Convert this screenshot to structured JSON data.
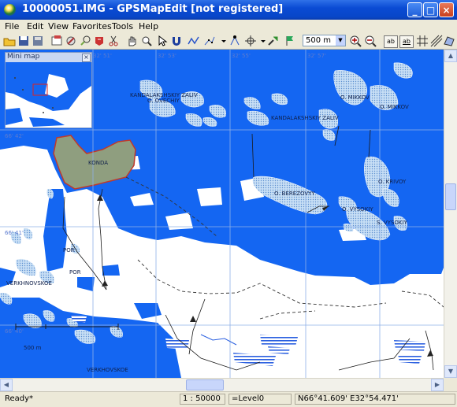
{
  "window": {
    "title": "10000051.IMG - GPSMapEdit [not registered]"
  },
  "menu": [
    "File",
    "Edit",
    "View",
    "Favorites",
    "Tools",
    "Help"
  ],
  "toolbar": {
    "scale_value": "500 m",
    "toggle_labels": [
      "ab",
      "ab"
    ]
  },
  "minimap": {
    "title": "Mini map"
  },
  "map": {
    "longitude_ticks": [
      "32' 51'",
      "32' 53'",
      "32' 55'",
      "32' 57'"
    ],
    "latitude_ticks": [
      "66' 42'",
      "66' 41'",
      "66' 40'"
    ],
    "labels": {
      "kandalakshskiy_zaliv_1": "KANDALAKSHSKIY ZALIV",
      "o_ovechiy": "O. OVECHIY",
      "kandalakshskiy_zaliv_2": "KANDALAKSHSKIY ZALIV",
      "o_mikkov_1": "O. MIKKOV",
      "o_mikkov_2": "O. MIKKOV",
      "konda": "KONDA",
      "o_berezovyy": "O. BEREZOVYY",
      "o_vysokiy": "O. VYSOKIY",
      "s_vysokiy": "S. VYSOKIY",
      "o_krivoy": "O. KRIVOY",
      "vernovskoe": "VERKHNOVSKOE",
      "verkhovskoe_2": "VERKHOVSKOE",
      "stor": "POR",
      "por": "POR",
      "scale_bar_label": "500 m"
    }
  },
  "status": {
    "ready": "Ready*",
    "scale": "1 : 50000",
    "level": "=Level0",
    "coords": "N66°41.609' E32°54.471'"
  },
  "colors": {
    "water": "#1466f2",
    "land": "#ffffff",
    "selected_fill": "#8f9e7f",
    "selected_border": "#c0392b",
    "grid": "#8fb0e8"
  }
}
